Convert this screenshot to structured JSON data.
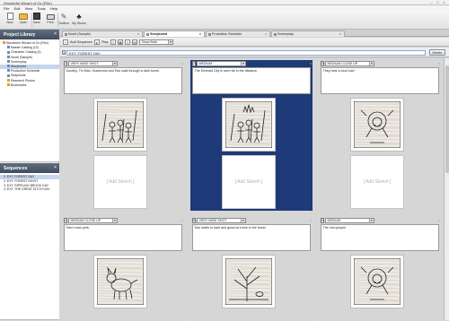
{
  "window": {
    "title": "Wonderful Wizard of Oz (Film)"
  },
  "menu": [
    "File",
    "Edit",
    "View",
    "Tools",
    "Help"
  ],
  "toolbar": [
    {
      "label": "New",
      "icon": "new-document-icon"
    },
    {
      "label": "Open",
      "icon": "folder-icon"
    },
    {
      "label": "Save",
      "icon": "save-icon"
    },
    {
      "label": "Print",
      "icon": "printer-icon"
    },
    {
      "label": "Toolbox",
      "icon": "toolbox-icon"
    },
    {
      "label": "My Studio",
      "icon": "studio-icon"
    }
  ],
  "library": {
    "title": "Project Library",
    "items": [
      {
        "label": "Wonderful Wizard of Oz (Film)",
        "level": 0,
        "color": "#d9a22b"
      },
      {
        "label": "Master Catalog (12)",
        "level": 1,
        "color": "#6f8fb8"
      },
      {
        "label": "Character Catalog (4)",
        "level": 1,
        "color": "#6f8fb8"
      },
      {
        "label": "Novel (Sample)",
        "level": 1,
        "color": "#6f8fb8"
      },
      {
        "label": "Screenplay",
        "level": 1,
        "color": "#6f8fb8"
      },
      {
        "label": "Storyboard",
        "level": 1,
        "color": "#6f8fb8",
        "selected": true
      },
      {
        "label": "Production Schedule",
        "level": 1,
        "color": "#6f8fb8"
      },
      {
        "label": "Shapshots",
        "level": 1,
        "color": "#6f8fb8"
      },
      {
        "label": "Research Photos",
        "level": 1,
        "color": "#d9a22b"
      },
      {
        "label": "Bookmarks",
        "level": 1,
        "color": "#d9a22b"
      }
    ]
  },
  "sequences": {
    "title": "Sequences",
    "items": [
      {
        "label": "1. EXT. FOREST DAY",
        "selected": true
      },
      {
        "label": "2. EXT. FOREST NIGHT"
      },
      {
        "label": "3. EXT. RIPPLING BROOK DAY"
      },
      {
        "label": "4. EXT. THE GREAT DITCH DAY"
      }
    ]
  },
  "tabs": [
    {
      "label": "Novel (Sample)"
    },
    {
      "label": "Storyboard",
      "active": true
    },
    {
      "label": "Production Schedule"
    },
    {
      "label": "Screenplay"
    }
  ],
  "subbar": {
    "add_sequence": "Add Sequence",
    "play": "Play",
    "view_mode": "Show Both"
  },
  "scene": {
    "number": "1",
    "heading": "EXT. FOREST DAY",
    "delete_label": "Delete"
  },
  "panels": [
    {
      "number": "1",
      "shot": "VERY WIDE SHOT",
      "description": "Dorothy, Tin Man, Scarecrow and Toto walk through a dark forest.",
      "has_sketch": true,
      "sketch": "forest-group",
      "selected": false
    },
    {
      "number": "2",
      "shot": "MEDIUM",
      "description": "The Emerald City is seen far in the distance.",
      "has_sketch": true,
      "sketch": "city-group",
      "selected": true
    },
    {
      "number": "3",
      "shot": "MEDIUM CLOSE UP",
      "description": "They hear a loud roar!",
      "has_sketch": true,
      "sketch": "lion-roar",
      "selected": false
    },
    {
      "number": "4",
      "shot": "MEDIUM CLOSE UP",
      "description": "Toto's ears perk.",
      "has_sketch": true,
      "sketch": "dog",
      "selected": false
    },
    {
      "number": "5",
      "shot": "VERY WIDE SHOT",
      "description": "Toto starts to bark and growl at a tree in the forest.",
      "has_sketch": true,
      "sketch": "tree",
      "selected": false
    },
    {
      "number": "6",
      "shot": "MEDIUM",
      "description": "The Lion jumps!",
      "has_sketch": true,
      "sketch": "lion-jump",
      "selected": false
    }
  ],
  "add_sketch_label": "[ Add Sketch ]",
  "colors": {
    "selected_panel": "#1e3a78",
    "panel_header": "#44536a",
    "accent": "#c5d5ec"
  }
}
